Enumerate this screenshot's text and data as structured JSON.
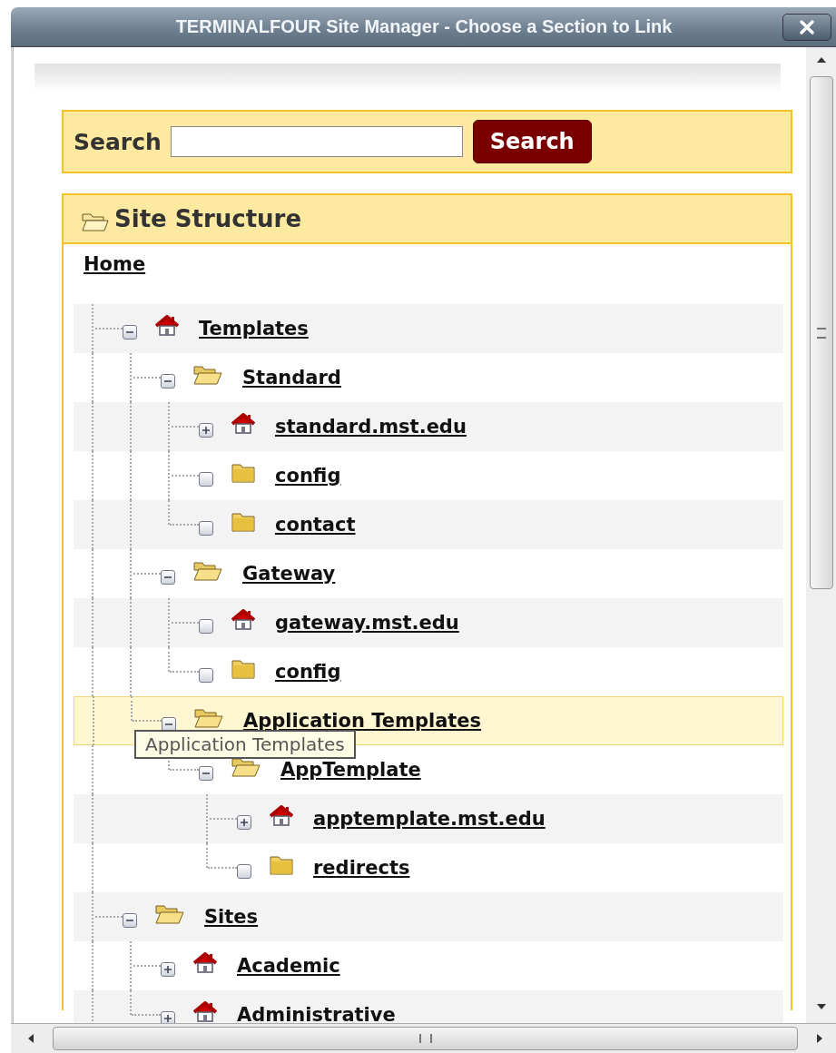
{
  "window": {
    "title": "TERMINALFOUR Site Manager - Choose a Section to Link"
  },
  "search": {
    "label": "Search",
    "button": "Search"
  },
  "site_structure": {
    "title": "Site Structure",
    "home": "Home"
  },
  "tree": {
    "items": [
      {
        "label": "Templates",
        "kind": "site",
        "expanded": true,
        "hovered": false,
        "children": [
          {
            "label": "Standard",
            "kind": "folder",
            "expanded": true,
            "hovered": false,
            "children": [
              {
                "label": "standard.mst.edu",
                "kind": "site",
                "expanded": false,
                "hovered": false
              },
              {
                "label": "config",
                "kind": "folder",
                "hovered": false
              },
              {
                "label": "contact",
                "kind": "folder",
                "hovered": false
              }
            ]
          },
          {
            "label": "Gateway",
            "kind": "folder",
            "expanded": true,
            "hovered": false,
            "children": [
              {
                "label": "gateway.mst.edu",
                "kind": "site",
                "hovered": false
              },
              {
                "label": "config",
                "kind": "folder",
                "hovered": false
              }
            ]
          },
          {
            "label": "Application Templates",
            "kind": "folder",
            "expanded": true,
            "hovered": true,
            "children": [
              {
                "label": "AppTemplate",
                "kind": "folder",
                "expanded": true,
                "hovered": false,
                "children": [
                  {
                    "label": "apptemplate.mst.edu",
                    "kind": "site",
                    "expanded": false,
                    "hovered": false
                  },
                  {
                    "label": "redirects",
                    "kind": "folder",
                    "hovered": false
                  }
                ]
              }
            ]
          }
        ]
      },
      {
        "label": "Sites",
        "kind": "folder",
        "expanded": true,
        "hovered": false,
        "children": [
          {
            "label": "Academic",
            "kind": "site",
            "expanded": false,
            "hovered": false
          },
          {
            "label": "Administrative",
            "kind": "site",
            "expanded": false,
            "hovered": false
          }
        ]
      }
    ],
    "tooltip": {
      "text": "Application Templates"
    }
  }
}
